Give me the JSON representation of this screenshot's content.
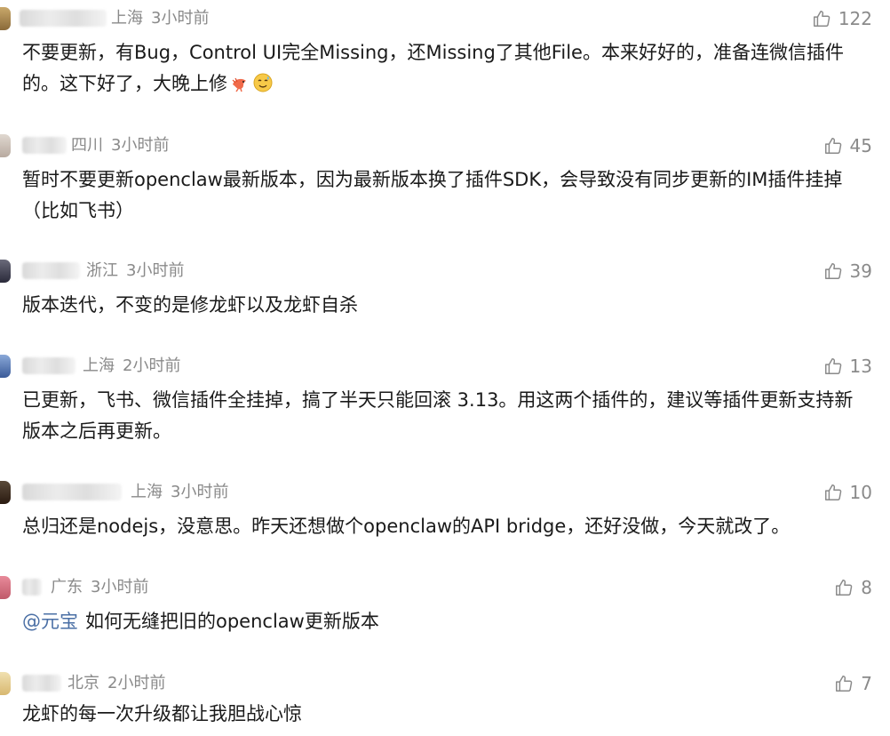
{
  "comments": [
    {
      "location": "上海",
      "time": "3小时前",
      "likes": "122",
      "text": "不要更新，有Bug，Control UI完全Missing，还Missing了其他File。本来好好的，准备连微信插件的。这下好了，大晚上修",
      "emojis": [
        "shrimp-emoji",
        "sweat-smile-emoji"
      ]
    },
    {
      "location": "四川",
      "time": "3小时前",
      "likes": "45",
      "text": "暂时不要更新openclaw最新版本，因为最新版本换了插件SDK，会导致没有同步更新的IM插件挂掉（比如飞书）"
    },
    {
      "location": "浙江",
      "time": "3小时前",
      "likes": "39",
      "text": "版本迭代，不变的是修龙虾以及龙虾自杀"
    },
    {
      "location": "上海",
      "time": "2小时前",
      "likes": "13",
      "text": "已更新，飞书、微信插件全挂掉，搞了半天只能回滚 3.13。用这两个插件的，建议等插件更新支持新版本之后再更新。"
    },
    {
      "location": "上海",
      "time": "3小时前",
      "likes": "10",
      "text": "总归还是nodejs，没意思。昨天还想做个openclaw的API bridge，还好没做，今天就改了。"
    },
    {
      "location": "广东",
      "time": "3小时前",
      "likes": "8",
      "mention": "@元宝",
      "text": "如何无缝把旧的openclaw更新版本"
    },
    {
      "location": "北京",
      "time": "2小时前",
      "likes": "7",
      "text": "龙虾的每一次升级都让我胆战心惊"
    }
  ],
  "colors": {
    "meta": "#8a8a8a",
    "text": "#1a1a1a",
    "mention": "#4a6fa5"
  },
  "icons": {
    "like": "thumbs-up-icon"
  }
}
